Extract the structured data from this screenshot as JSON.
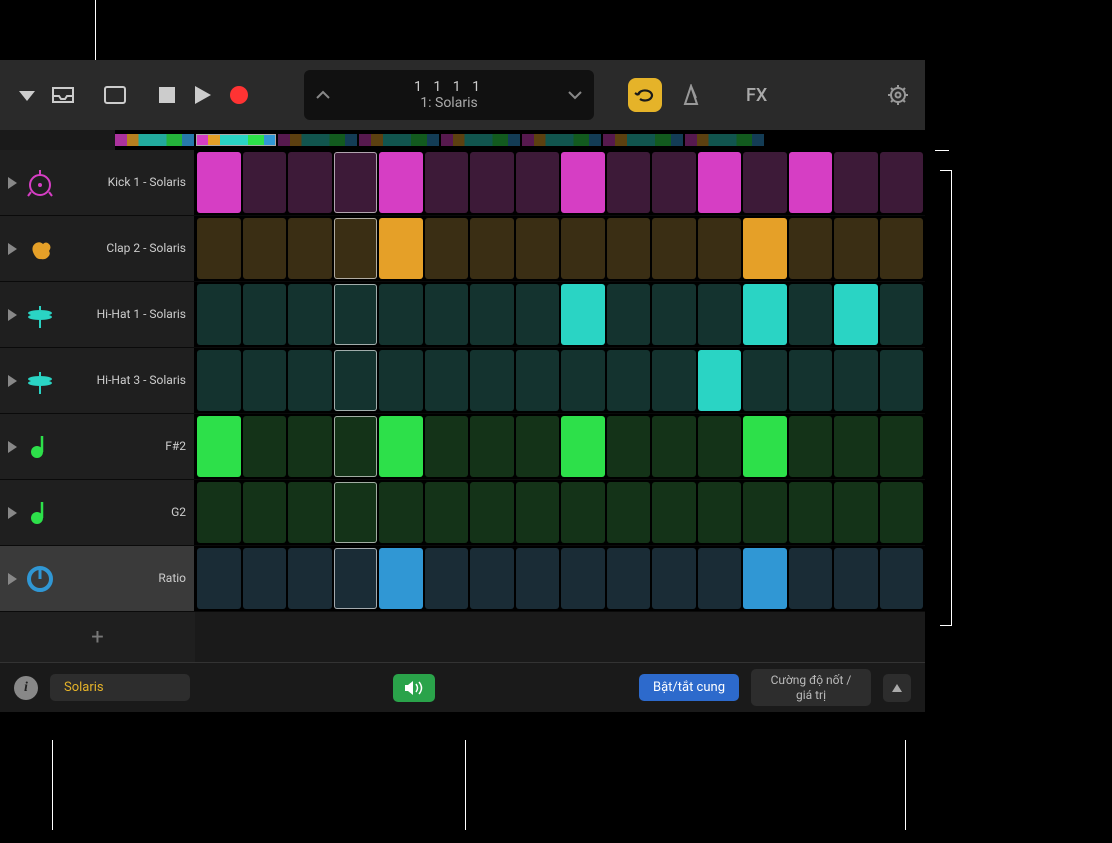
{
  "toolbar": {
    "lcd_position": "1  1  1      1",
    "lcd_name": "1: Solaris",
    "fx_label": "FX"
  },
  "rows": [
    {
      "label": "Kick 1 - Solaris",
      "icon": "kick",
      "on_color": "#d63ec4",
      "off_color": "#3d1a38",
      "icon_stroke": "#d63ec4",
      "steps": [
        1,
        0,
        0,
        0,
        1,
        0,
        0,
        0,
        1,
        0,
        0,
        1,
        0,
        1,
        0,
        0
      ],
      "selected": false
    },
    {
      "label": "Clap 2 - Solaris",
      "icon": "clap",
      "on_color": "#e5a028",
      "off_color": "#3a2e14",
      "icon_stroke": "#e5a028",
      "steps": [
        0,
        0,
        0,
        0,
        1,
        0,
        0,
        0,
        0,
        0,
        0,
        0,
        1,
        0,
        0,
        0
      ],
      "selected": false
    },
    {
      "label": "Hi-Hat 1 - Solaris",
      "icon": "hihat",
      "on_color": "#2ad4c4",
      "off_color": "#14332f",
      "icon_stroke": "#2ad4c4",
      "steps": [
        0,
        0,
        0,
        0,
        0,
        0,
        0,
        0,
        1,
        0,
        0,
        0,
        1,
        0,
        1,
        0
      ],
      "selected": false
    },
    {
      "label": "Hi-Hat 3 - Solaris",
      "icon": "hihat",
      "on_color": "#2ad4c4",
      "off_color": "#14332f",
      "icon_stroke": "#2ad4c4",
      "steps": [
        0,
        0,
        0,
        0,
        0,
        0,
        0,
        0,
        0,
        0,
        0,
        1,
        0,
        0,
        0,
        0
      ],
      "selected": false
    },
    {
      "label": "F#2",
      "icon": "note",
      "on_color": "#2de04a",
      "off_color": "#143318",
      "icon_stroke": "#2de04a",
      "steps": [
        1,
        0,
        0,
        0,
        1,
        0,
        0,
        0,
        1,
        0,
        0,
        0,
        1,
        0,
        0,
        0
      ],
      "selected": false
    },
    {
      "label": "G2",
      "icon": "note",
      "on_color": "#2de04a",
      "off_color": "#143318",
      "icon_stroke": "#2de04a",
      "steps": [
        0,
        0,
        0,
        0,
        0,
        0,
        0,
        0,
        0,
        0,
        0,
        0,
        0,
        0,
        0,
        0
      ],
      "selected": false
    },
    {
      "label": "Ratio",
      "icon": "knob",
      "on_color": "#3097d4",
      "off_color": "#1a2c36",
      "icon_stroke": "#3097d4",
      "steps": [
        0,
        0,
        0,
        0,
        1,
        0,
        0,
        0,
        0,
        0,
        0,
        0,
        1,
        0,
        0,
        0
      ],
      "selected": true
    }
  ],
  "playhead_step": 3,
  "add_row_label": "+",
  "footer": {
    "preset": "Solaris",
    "toggle_arc": "Bật/tắt cung",
    "velocity": "Cường độ nốt / giá trị"
  }
}
